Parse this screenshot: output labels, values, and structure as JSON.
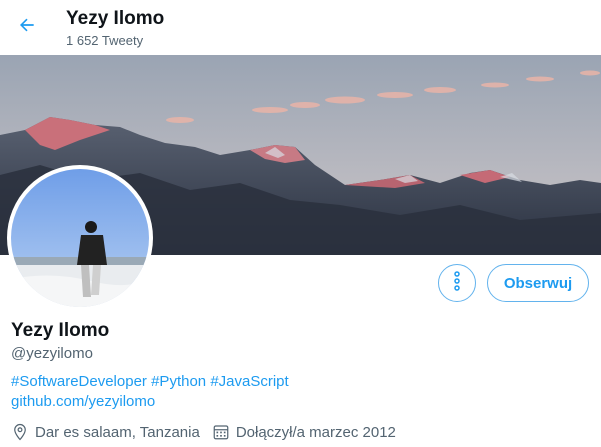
{
  "header": {
    "name": "Yezy Ilomo",
    "tweet_count": "1 652 Tweety"
  },
  "profile": {
    "display_name": "Yezy Ilomo",
    "handle": "@yezyilomo",
    "bio_tags": [
      "#SoftwareDeveloper",
      "#Python",
      "#JavaScript"
    ],
    "website": "github.com/yezyilomo",
    "location": "Dar es salaam, Tanzania",
    "joined": "Dołączył/a marzec 2012"
  },
  "actions": {
    "follow_label": "Obserwuj"
  },
  "icons": {
    "back": "arrow-left-icon",
    "more": "more-vertical-icon",
    "location": "location-pin-icon",
    "calendar": "calendar-icon"
  },
  "colors": {
    "accent": "#1d9bf0",
    "text_primary": "#0f1419",
    "text_secondary": "#536471"
  }
}
